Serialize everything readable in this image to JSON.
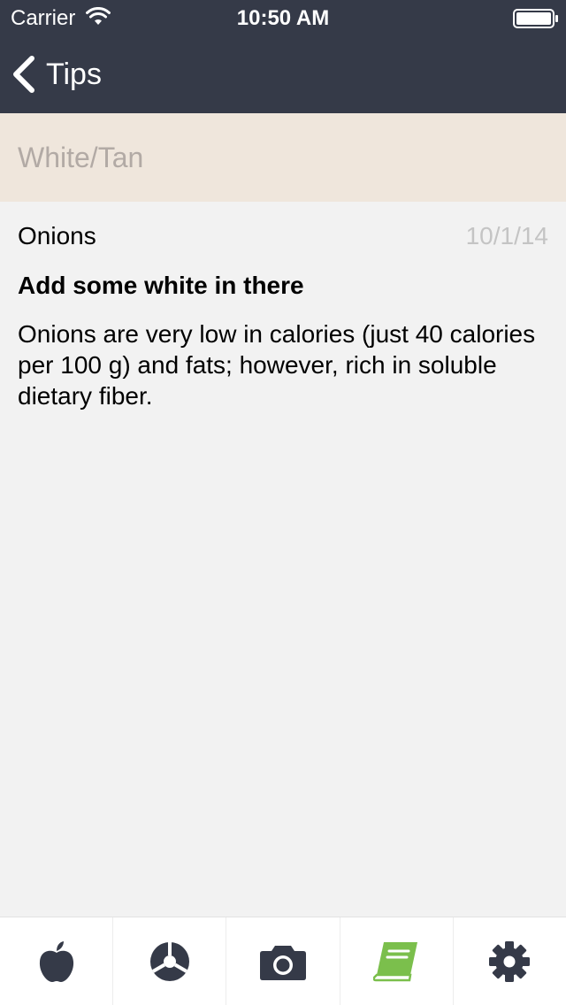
{
  "status_bar": {
    "carrier": "Carrier",
    "time": "10:50 AM",
    "icons": [
      "wifi-icon",
      "battery-icon"
    ]
  },
  "nav": {
    "back_label": "Tips",
    "back_icon": "chevron-left-icon"
  },
  "category": {
    "title": "White/Tan"
  },
  "tip": {
    "name": "Onions",
    "date": "10/1/14",
    "heading": "Add some white in there",
    "body": "Onions are very low in calories (just 40 calories per 100 g) and fats; however, rich in soluble dietary fiber."
  },
  "tab_bar": {
    "tabs": [
      {
        "icon": "apple-icon",
        "selected": false
      },
      {
        "icon": "color-wheel-icon",
        "selected": false
      },
      {
        "icon": "camera-icon",
        "selected": false
      },
      {
        "icon": "book-icon",
        "selected": true
      },
      {
        "icon": "gear-icon",
        "selected": false
      }
    ],
    "active_color": "#7bbf4c",
    "inactive_color": "#353a48"
  },
  "colors": {
    "header_bg": "#353a48",
    "category_bg": "#efe6dc",
    "category_text": "#b2aaa5",
    "content_bg": "#f2f2f2",
    "date_text": "#c4c4c4"
  }
}
